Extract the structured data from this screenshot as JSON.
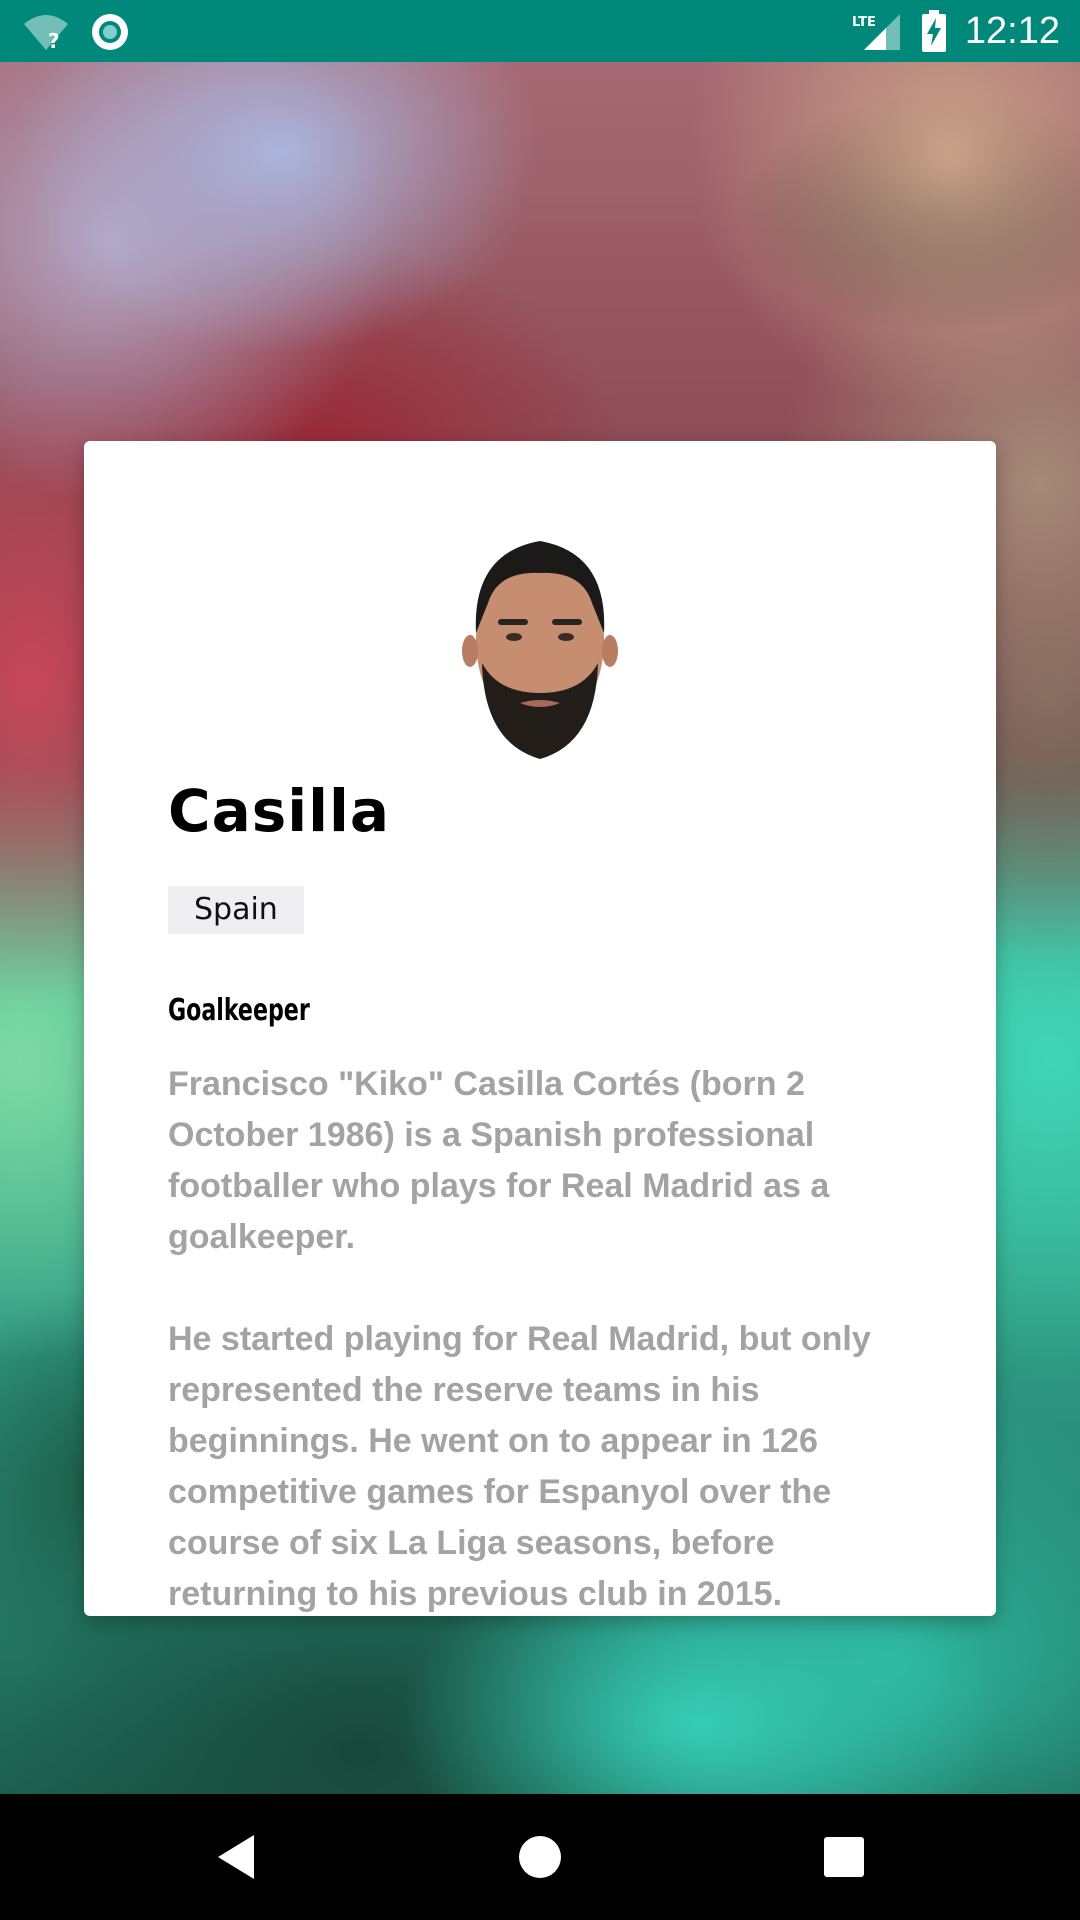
{
  "status_bar": {
    "time": "12:12",
    "network_label": "LTE",
    "wifi_icon": "wifi-unknown-icon",
    "sync_icon": "sync-circle-icon",
    "signal_icon": "cell-signal-icon",
    "battery_icon": "battery-charging-icon",
    "background_color": "#00897b"
  },
  "card": {
    "name": "Casilla",
    "country": "Spain",
    "position": "Goalkeeper",
    "bio": [
      "Francisco \"Kiko\" Casilla Cortés (born 2 October 1986) is a Spanish professional footballer who plays for Real Madrid as a goalkeeper.",
      "He started playing for Real Madrid, but only represented the reserve teams in his beginnings. He went on to appear in 126 competitive games for Espanyol over the course of six La Liga seasons, before returning to his previous club in 2015."
    ]
  },
  "nav_bar": {
    "back_icon": "back-triangle-icon",
    "home_icon": "home-circle-icon",
    "recents_icon": "recents-square-icon"
  }
}
